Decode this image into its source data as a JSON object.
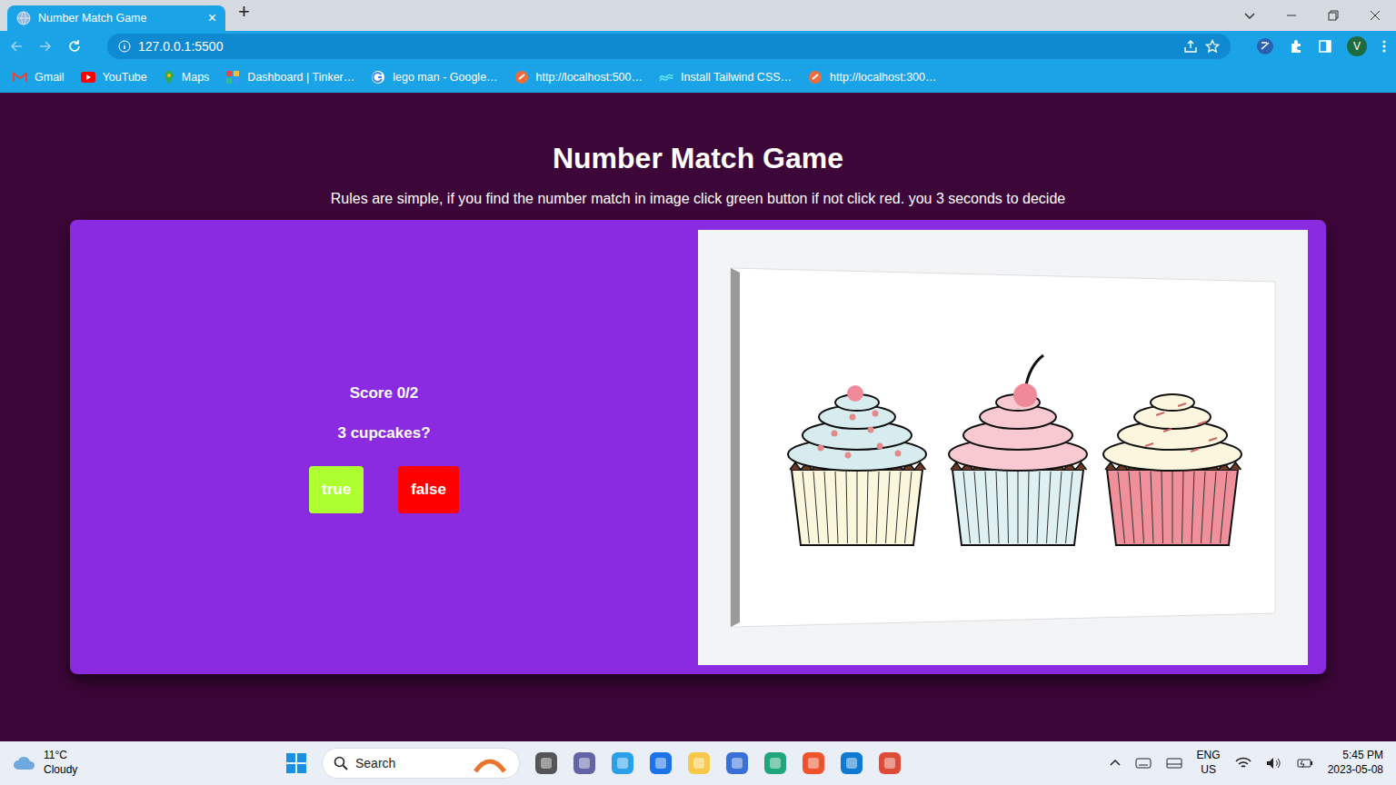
{
  "browser": {
    "tabs": [
      {
        "label": "Number Match Game",
        "selected": true
      }
    ],
    "tab_close": "×",
    "new_tab": "+",
    "address": "127.0.0.1:5500",
    "profile": "V",
    "bookmarks": [
      "Gmail",
      "YouTube",
      "Maps",
      "Dashboard | Tinker…",
      "lego man - Google…",
      "http://localhost:500…",
      "Install Tailwind CSS…",
      "http://localhost:300…"
    ]
  },
  "page": {
    "title": "Number Match Game",
    "rules": "Rules are simple, if you find the number match in image click green button if not click red. you 3 seconds to decide",
    "score": "Score 0/2",
    "question": "3 cupcakes?",
    "buttons": [
      {
        "label": "true",
        "color": "#adff2f"
      },
      {
        "label": "false",
        "color": "#ff0000"
      }
    ]
  },
  "taskbar": {
    "weather": {
      "temperature": "11°C",
      "condition": "Cloudy"
    },
    "search": "Search",
    "language": [
      "ENG",
      "US"
    ],
    "time": "5:45 PM",
    "date": "2023-05-08"
  }
}
